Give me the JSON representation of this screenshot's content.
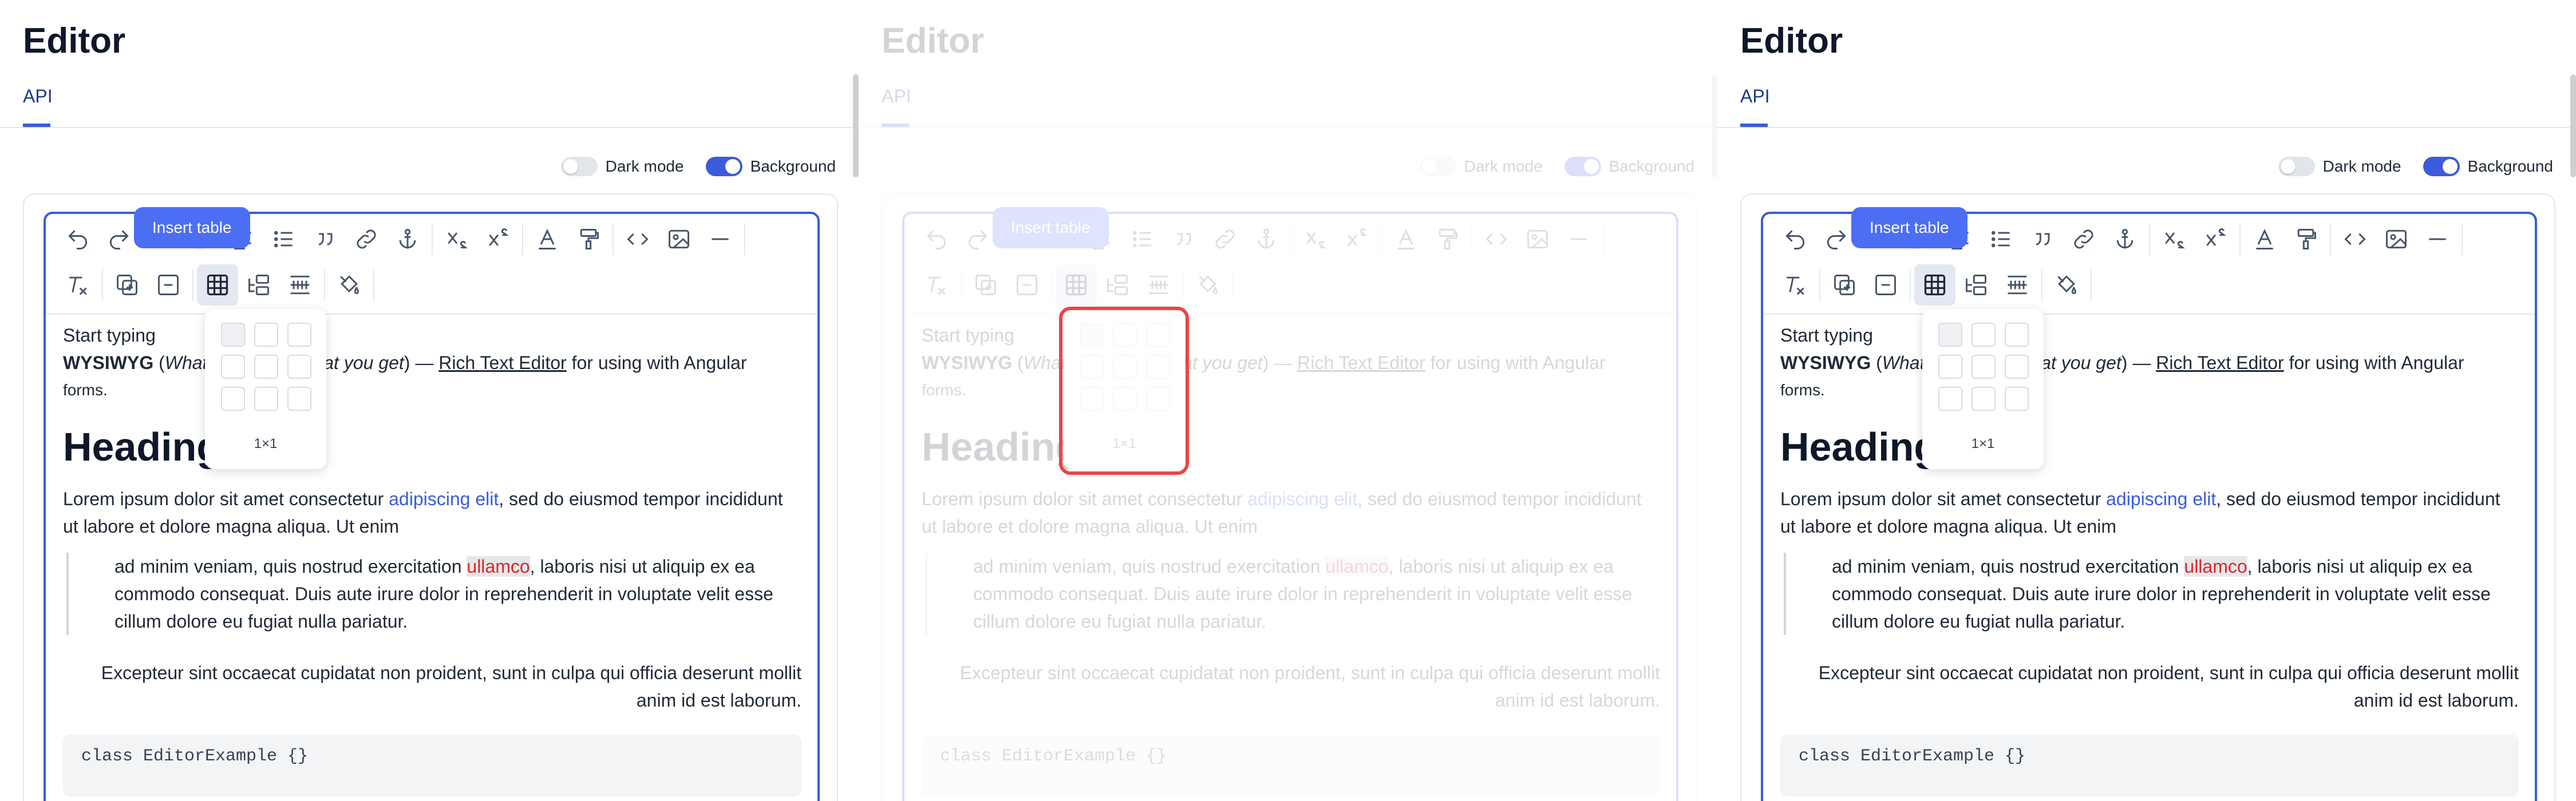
{
  "page_title": "Editor",
  "tab_label": "API",
  "toggles": {
    "dark_mode": "Dark mode",
    "background": "Background"
  },
  "tooltip": "Insert table",
  "table_size": "1×1",
  "content": {
    "placeholder": "Start typing",
    "intro_bold": "WYSIWYG",
    "intro_open": " (",
    "intro_em": "What you see is what you get",
    "intro_after_em": ") — ",
    "intro_link": "Rich Text Editor",
    "intro_rest": " for using with Angular",
    "intro_tail": "forms.",
    "heading": "Heading",
    "p1_start": "Lorem ipsum dolor sit amet consectetur ",
    "p1_link": "adipiscing elit",
    "p1_end": ", sed do eiusmod tempor incididunt ut labore et dolore magna aliqua. Ut enim",
    "quote_start": "ad minim veniam, quis nostrud exercitation ",
    "quote_hl": "ullamco",
    "quote_end": ", laboris nisi ut aliquip ex ea commodo consequat. Duis aute irure dolor in reprehenderit in voluptate velit esse cillum dolore eu fugiat nulla pariatur.",
    "right_para": "Excepteur sint occaecat cupidatat non proident, sunt in culpa qui officia deserunt mollit anim id est laborum.",
    "code": "class EditorExample {}"
  },
  "toolbar_icons": [
    "undo-icon",
    "redo-icon",
    "bold-icon",
    "italic-icon",
    "underline-icon",
    "strikethrough-icon",
    "align-icon",
    "list-icon",
    "blockquote-icon",
    "link-icon",
    "anchor-icon",
    "subscript-icon",
    "superscript-icon",
    "text-color-icon",
    "paint-format-icon",
    "code-icon",
    "image-icon",
    "horizontal-rule-icon",
    "clear-format-icon",
    "add-row-icon",
    "remove-row-icon",
    "insert-table-icon",
    "merge-cells-icon",
    "split-cells-icon",
    "cell-fill-icon"
  ],
  "colors": {
    "accent": "#3b5bdb",
    "tooltip": "#4c6ef5",
    "highlight": "#dc2626"
  }
}
